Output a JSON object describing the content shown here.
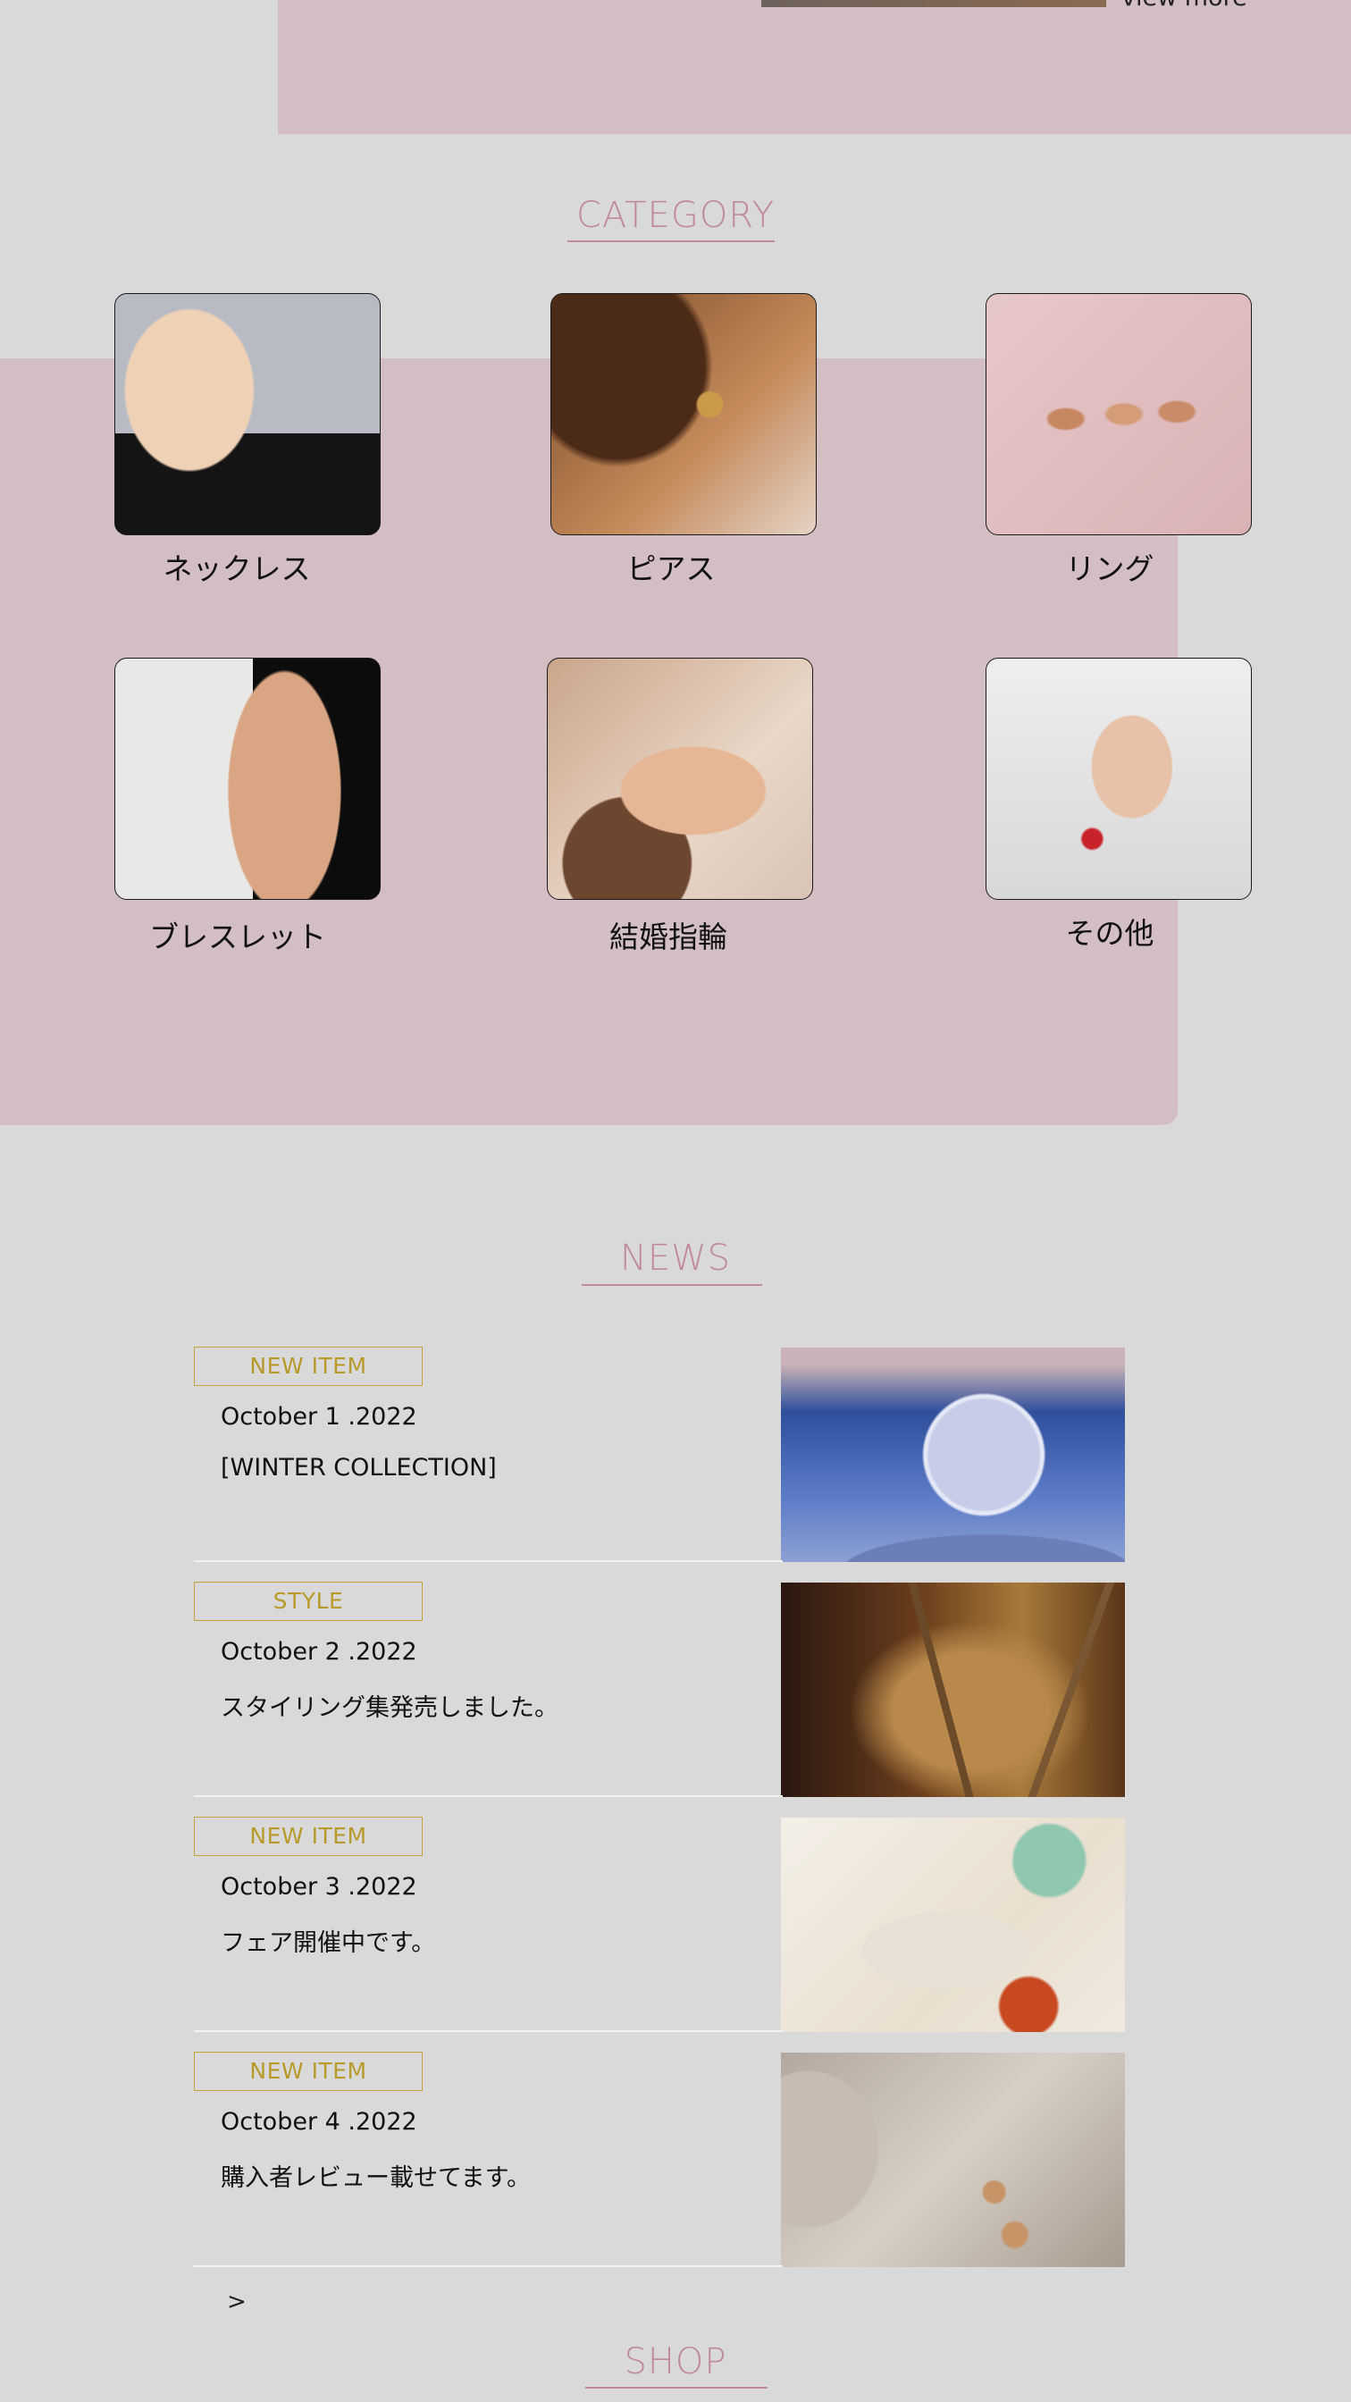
{
  "top": {
    "view_more": "view more"
  },
  "category": {
    "title": "CATEGORY",
    "items": [
      {
        "label": "ネックレス",
        "image": "necklace-photo"
      },
      {
        "label": "ピアス",
        "image": "earring-photo"
      },
      {
        "label": "リング",
        "image": "ring-photo"
      },
      {
        "label": "ブレスレット",
        "image": "bracelet-photo"
      },
      {
        "label": "結婚指輪",
        "image": "wedding-ring-photo"
      },
      {
        "label": "その他",
        "image": "other-photo"
      }
    ]
  },
  "news": {
    "title": "NEWS",
    "items": [
      {
        "tag": "NEW ITEM",
        "date": "October 1 .2022",
        "text": "[WINTER COLLECTION]",
        "image": "frozen-bubble-photo"
      },
      {
        "tag": "STYLE",
        "date": "October 2 .2022",
        "text": "スタイリング集発売しました。",
        "image": "gold-chain-photo"
      },
      {
        "tag": "NEW ITEM",
        "date": "October 3 .2022",
        "text": "フェア開催中です。",
        "image": "stone-rings-photo"
      },
      {
        "tag": "NEW ITEM",
        "date": "October 4 .2022",
        "text": "購入者レビュー載せてます。",
        "image": "dried-flowers-rings-photo"
      }
    ],
    "more_arrow": ">"
  },
  "shop": {
    "title": "SHOP"
  },
  "colors": {
    "accent_pink": "#c08a99",
    "band_pink": "#d3bfc3",
    "tag_gold": "#c3a33a",
    "background": "#d9d9d9"
  }
}
